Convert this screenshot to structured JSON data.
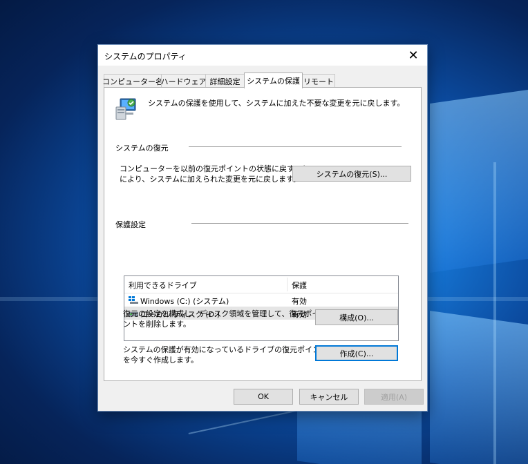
{
  "window": {
    "title": "システムのプロパティ",
    "close_glyph": "✕"
  },
  "tabs": [
    {
      "label": "コンピューター名",
      "active": false
    },
    {
      "label": "ハードウェア",
      "active": false
    },
    {
      "label": "詳細設定",
      "active": false
    },
    {
      "label": "システムの保護",
      "active": true
    },
    {
      "label": "リモート",
      "active": false
    }
  ],
  "intro_text": "システムの保護を使用して、システムに加えた不要な変更を元に戻します。",
  "restore": {
    "group_label": "システムの復元",
    "description_line1": "コンピューターを以前の復元ポイントの状態に戻すこと",
    "description_line2": "により、システムに加えられた変更を元に戻します。",
    "button_label": "システムの復元(S)..."
  },
  "protection": {
    "group_label": "保護設定",
    "columns": [
      "利用できるドライブ",
      "保護"
    ],
    "drives": [
      {
        "name": "Windows (C:) (システム)",
        "status": "有効",
        "icon": "windows-drive-icon",
        "selected": false
      },
      {
        "name": "ローカル ディスク (D:)",
        "status": "有効",
        "icon": "local-disk-icon",
        "selected": true
      }
    ],
    "configure_desc_line1": "復元の設定を構成し、ディスク領域を管理して、復元ポイ",
    "configure_desc_line2": "ントを削除します。",
    "configure_button": "構成(O)...",
    "create_desc_line1": "システムの保護が有効になっているドライブの復元ポイント",
    "create_desc_line2": "を今すぐ作成します。",
    "create_button": "作成(C)..."
  },
  "footer": {
    "ok": "OK",
    "cancel": "キャンセル",
    "apply": "適用(A)"
  },
  "colors": {
    "accent": "#0078d7",
    "dialog_bg": "#f0f0f0",
    "button_bg": "#e1e1e1",
    "selected_row": "#e5e5e5"
  }
}
